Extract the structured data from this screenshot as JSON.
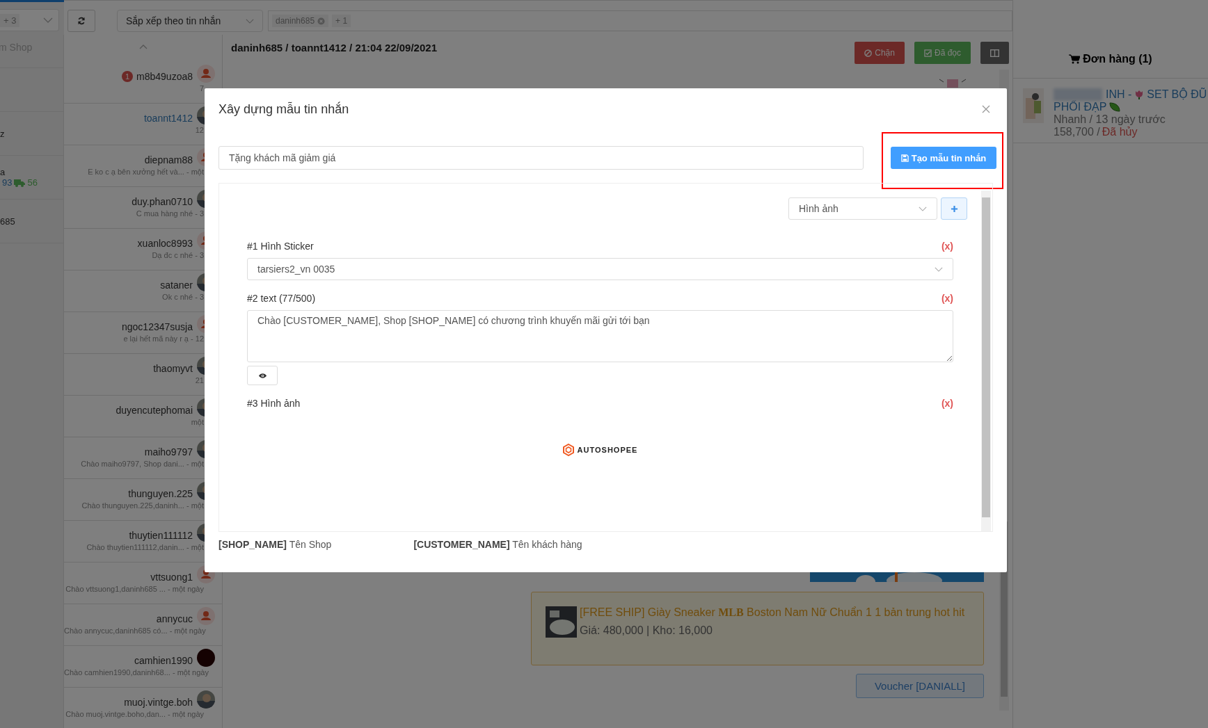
{
  "top_bar": {
    "account_filter": {
      "chip": "+ 3"
    },
    "sort_select": {
      "value": "Sắp xếp theo tin nhắn"
    },
    "tag_filter": {
      "chips": [
        {
          "label": "daninh685",
          "removable": true
        },
        {
          "label": "+ 1",
          "removable": false
        }
      ]
    }
  },
  "shop_column": {
    "title": "m Shop",
    "rows": [
      {
        "name": "z"
      },
      {
        "name": "a",
        "unread": "93",
        "shipping": "56"
      },
      {
        "name": "685"
      }
    ]
  },
  "conversations": [
    {
      "kind": "default",
      "name": "m8b49uzoa8",
      "badge": "1",
      "preview": "7",
      "selected": false
    },
    {
      "name": "toannt1412",
      "preview": "12",
      "selected": true
    },
    {
      "kind": "default",
      "name": "diepnam88",
      "preview": "E ko c ạ bên xưởng hết và... - một",
      "selected": false
    },
    {
      "name": "duy.phan0710",
      "preview": "C mua hàng nhé - 3",
      "selected": false
    },
    {
      "kind": "default",
      "name": "xuanloc8993",
      "preview": "Dạ đc c nhé - 3",
      "selected": false
    },
    {
      "name": "sataner",
      "preview": "Ok c nhé - 3",
      "selected": false
    },
    {
      "kind": "default",
      "name": "ngoc12347susja",
      "preview": "e lại hết mã này r ạ - 12",
      "selected": false
    },
    {
      "name": "thaomyvt",
      "preview": "21",
      "selected": false
    },
    {
      "name": "duyencutephomai",
      "preview": "một",
      "selected": false
    },
    {
      "name": "maiho9797",
      "preview": "Chào maiho9797, Shop dani... - một",
      "selected": false
    },
    {
      "name": "thunguyen.225",
      "preview": "Chào thunguyen.225,daninh... - một",
      "selected": false
    },
    {
      "name": "thuytien111112",
      "preview": "Chào thuytien111112,danin... - một",
      "selected": false
    },
    {
      "kind": "default",
      "name": "vttsuong1",
      "preview": "Chào vttsuong1,daninh685 ... - một ngày",
      "selected": false
    },
    {
      "kind": "default",
      "name": "annycuc",
      "preview": "Chào annycuc,daninh685 có... - một ngày",
      "selected": false
    },
    {
      "kind": "dark",
      "name": "camhien1990",
      "preview": "Chào camhien1990,daninh68... - một ngày",
      "selected": false
    },
    {
      "name": "muoj.vintge.boh",
      "preview": "Chào muoj.vintge.boho,dan... - một ngày",
      "selected": false
    }
  ],
  "chat": {
    "title": "daninh685 / toannt1412 / 21:04 22/09/2021",
    "buttons": [
      {
        "kind": "block",
        "label": "Chặn"
      },
      {
        "kind": "read",
        "label": "Đã đọc"
      },
      {
        "kind": "layout"
      }
    ],
    "product_card": {
      "title": "[FREE SHIP] Giày Sneaker **MLB** Boston Nam Nữ Chuẩn 1 1 bản trung hot hit",
      "details": "Giá: 480,000 | Kho: 16,000"
    },
    "voucher_button": "Voucher [DANIALL]"
  },
  "orders": {
    "title": "Đơn hàng (1)",
    "items": [
      {
        "kind": "cancelled",
        "title_start": "INH -",
        "title_end": "SET BỘ ĐŨ",
        "title_line2": "PHỐI ĐẠP",
        "meta": "Nhanh / 13 ngày trước",
        "price": "158,700 /",
        "status": "Đã hủy"
      }
    ]
  },
  "modal": {
    "title": "Xây dựng mẫu tin nhắn",
    "name_field": {
      "value": "Tặng khách mã giảm giá"
    },
    "create_button": {
      "label": "Tạo mẫu tin nhắn",
      "highlighted": true
    },
    "block_type_select": "Hình ảnh",
    "blocks": [
      {
        "kind": "sticker",
        "label": "#1 Hình Sticker",
        "value": "tarsiers2_vn 0035",
        "remove": "(x)"
      },
      {
        "kind": "text",
        "label": "#2 text (77/500)",
        "value": "Chào [CUSTOMER_NAME], Shop [SHOP_NAME] có chương trình khuyến mãi gửi tới bạn",
        "remove": "(x)"
      },
      {
        "label": "#3 Hình ảnh",
        "logo_text": "AUTOSHOPEE",
        "remove": "(x)"
      }
    ],
    "legend": [
      {
        "token": "[SHOP_NAME]",
        "meaning": "Tên Shop"
      },
      {
        "token": "[CUSTOMER_NAME]",
        "meaning": "Tên khách hàng"
      }
    ]
  }
}
